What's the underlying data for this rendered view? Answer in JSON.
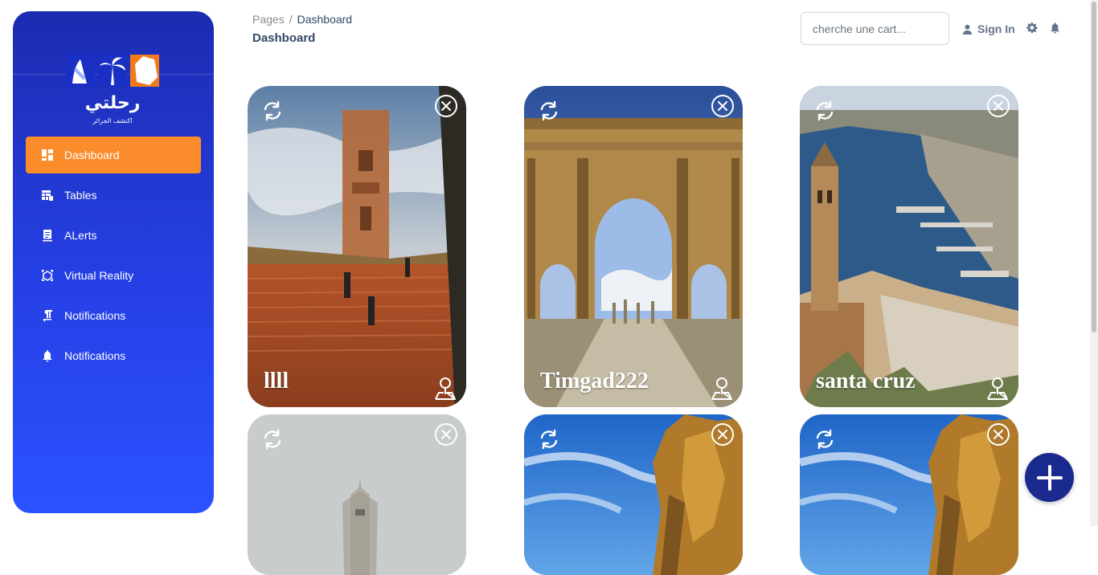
{
  "sidebar": {
    "logo": {
      "arabic": "رحلتي",
      "tagline": "اكتشف الجزائر"
    },
    "items": [
      {
        "label": "Dashboard",
        "icon": "dashboard-icon",
        "active": true
      },
      {
        "label": "Tables",
        "icon": "table-icon"
      },
      {
        "label": "ALerts",
        "icon": "receipt-icon"
      },
      {
        "label": "Virtual Reality",
        "icon": "vr-icon"
      },
      {
        "label": "Notifications",
        "icon": "format-textdirection-icon"
      },
      {
        "label": "Notifications",
        "icon": "bell-icon"
      }
    ]
  },
  "header": {
    "breadcrumb": {
      "root": "Pages",
      "separator": "/",
      "current": "Dashboard"
    },
    "title": "Dashboard",
    "search_placeholder": "cherche une cart...",
    "signin_label": "Sign In"
  },
  "cards": [
    {
      "title": "llll",
      "image": "tlemcen-mansourah-minaret-photo"
    },
    {
      "title": "Timgad222",
      "image": "timgad-arch-photo"
    },
    {
      "title": "santa cruz",
      "image": "oran-santa-cruz-photo"
    },
    {
      "title": "",
      "image": "maqam-echahid-monument-photo"
    },
    {
      "title": "",
      "image": "sandstone-cliff-sky-photo"
    },
    {
      "title": "",
      "image": "sandstone-cliff-sky-photo"
    }
  ],
  "colors": {
    "sidebar_top": "#1c2bb0",
    "sidebar_bottom": "#2b52ff",
    "active": "#fb8c2b",
    "fab": "#1a2a8f",
    "text_dark": "#344767"
  }
}
